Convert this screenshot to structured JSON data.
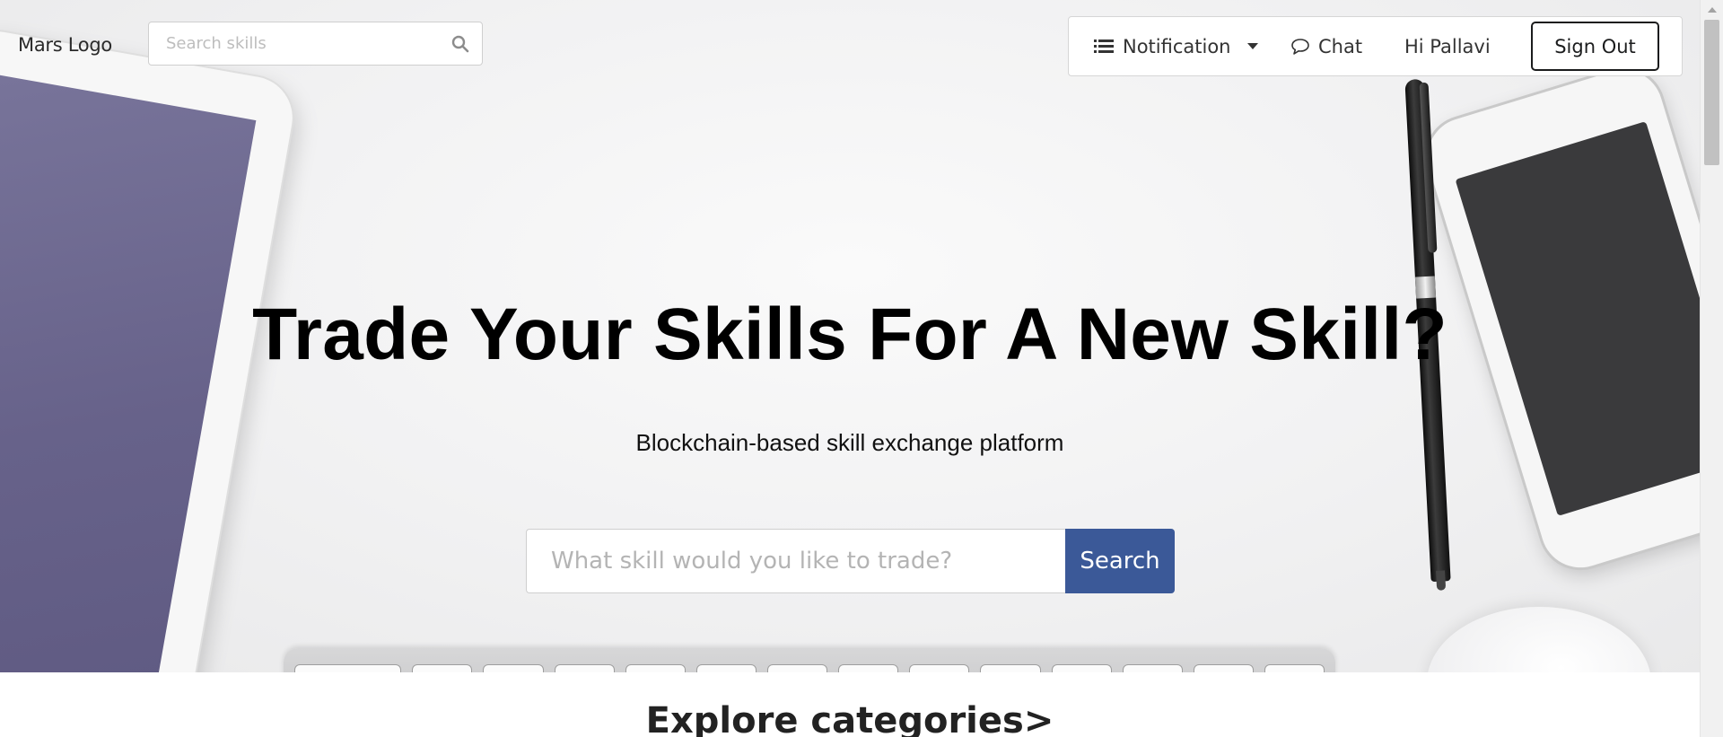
{
  "header": {
    "logo_text": "Mars Logo",
    "search": {
      "placeholder": "Search skills",
      "icon": "search-icon"
    },
    "nav": {
      "notification_label": "Notification",
      "notification_icon": "list-icon",
      "chat_label": "Chat",
      "chat_icon": "chat-bubble-icon",
      "greeting": "Hi Pallavi",
      "signout_label": "Sign Out"
    }
  },
  "hero": {
    "headline": "Trade Your Skills For A New Skill?",
    "subtitle": "Blockchain-based skill exchange platform",
    "search": {
      "placeholder": "What skill would you like to trade?",
      "button_label": "Search"
    }
  },
  "sections": {
    "explore_heading": "Explore categories>"
  },
  "colors": {
    "accent": "#3b5998",
    "text": "#1b1c1d"
  }
}
